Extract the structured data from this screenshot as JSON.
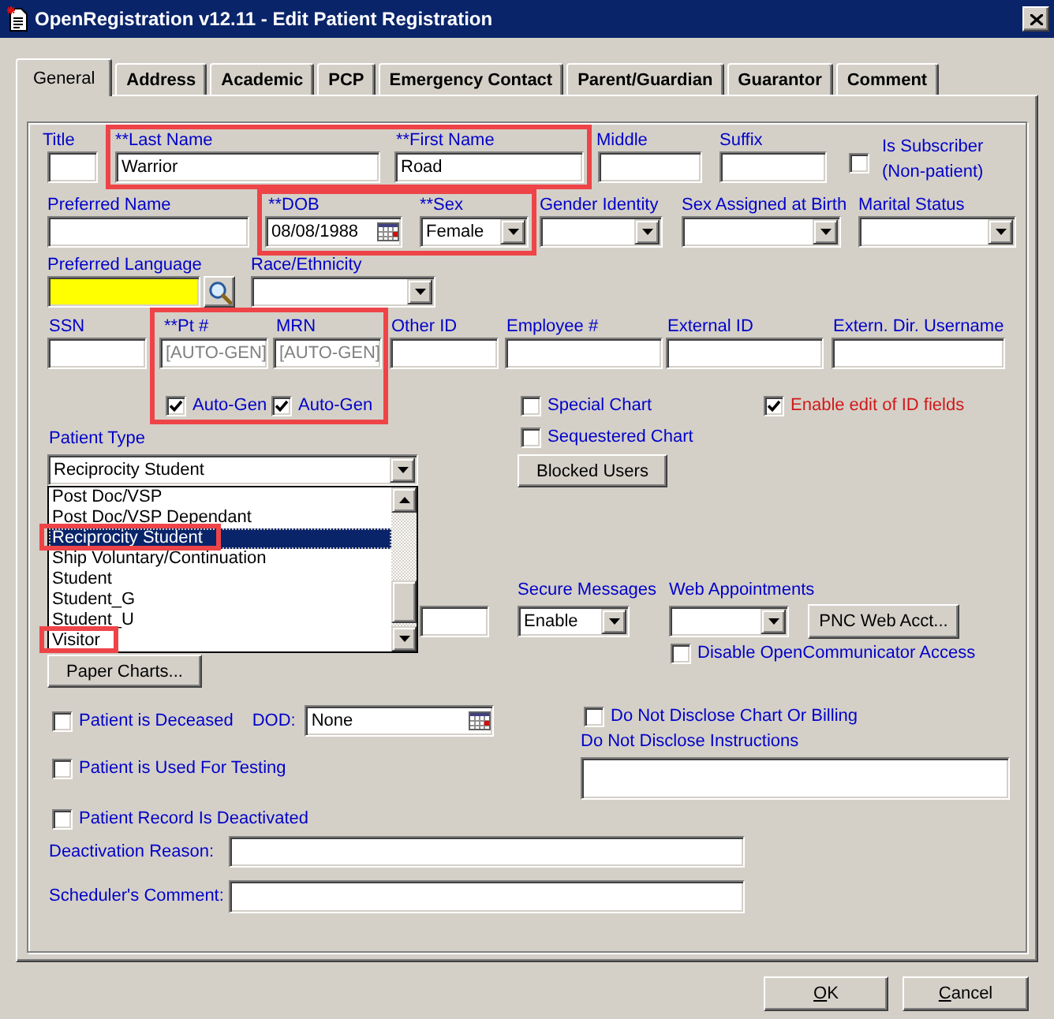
{
  "window": {
    "title": "OpenRegistration v12.11 - Edit Patient Registration"
  },
  "tabs": [
    {
      "label": "General",
      "selected": true
    },
    {
      "label": "Address",
      "selected": false
    },
    {
      "label": "Academic",
      "selected": false
    },
    {
      "label": "PCP",
      "selected": false
    },
    {
      "label": "Emergency Contact",
      "selected": false
    },
    {
      "label": "Parent/Guardian",
      "selected": false
    },
    {
      "label": "Guarantor",
      "selected": false
    },
    {
      "label": "Comment",
      "selected": false
    }
  ],
  "title_field": {
    "label": "Title"
  },
  "name_group": {
    "annotated": true,
    "last_name": {
      "label": "**Last Name",
      "value": "Warrior"
    },
    "first_name": {
      "label": "**First Name",
      "value": "Road"
    }
  },
  "middle": {
    "label": "Middle"
  },
  "suffix": {
    "label": "Suffix"
  },
  "is_subscriber": {
    "label": "Is Subscriber (Non-patient)",
    "checked": false
  },
  "preferred_name": {
    "label": "Preferred Name"
  },
  "dob_sex_group": {
    "annotated": true,
    "dob": {
      "label": "**DOB",
      "value": "08/08/1988"
    },
    "sex": {
      "label": "**Sex",
      "value": "Female"
    }
  },
  "gender_identity": {
    "label": "Gender Identity"
  },
  "sex_assigned_at_birth": {
    "label": "Sex Assigned at Birth"
  },
  "marital_status": {
    "label": "Marital Status"
  },
  "preferred_language": {
    "label": "Preferred Language",
    "required": true
  },
  "race_ethnicity": {
    "label": "Race/Ethnicity"
  },
  "ssn": {
    "label": "SSN"
  },
  "id_group": {
    "annotated": true,
    "fields": [
      {
        "label": "**Pt #",
        "placeholder": "[AUTO-GEN]",
        "auto_gen": {
          "label": "Auto-Gen",
          "checked": true
        }
      },
      {
        "label": "MRN",
        "placeholder": "[AUTO-GEN]",
        "auto_gen": {
          "label": "Auto-Gen",
          "checked": true
        }
      }
    ]
  },
  "other_ids": [
    {
      "label": "Other ID"
    },
    {
      "label": "Employee #"
    },
    {
      "label": "External ID"
    },
    {
      "label": "Extern. Dir. Username"
    }
  ],
  "special_chart": {
    "label": "Special Chart",
    "checked": false
  },
  "enable_edit_id_fields": {
    "label": "Enable edit of ID fields",
    "checked": true
  },
  "patient_type": {
    "label": "Patient Type",
    "value": "Reciprocity Student",
    "expanded": true,
    "options": [
      {
        "label": "Post Doc/VSP",
        "selected": false,
        "annotated": false
      },
      {
        "label": "Post Doc/VSP Dependant",
        "selected": false,
        "annotated": false
      },
      {
        "label": "Reciprocity Student",
        "selected": true,
        "annotated": true
      },
      {
        "label": "Ship Voluntary/Continuation",
        "selected": false,
        "annotated": false
      },
      {
        "label": "Student",
        "selected": false,
        "annotated": false
      },
      {
        "label": "Student_G",
        "selected": false,
        "annotated": false
      },
      {
        "label": "Student_U",
        "selected": false,
        "annotated": false
      },
      {
        "label": "Visitor",
        "selected": false,
        "annotated": true
      }
    ]
  },
  "sequestered_chart": {
    "label": "Sequestered Chart",
    "checked": false
  },
  "blocked_users_button": {
    "label": "Blocked Users"
  },
  "secure_messages": {
    "label": "Secure Messages",
    "value": "Enable"
  },
  "web_appointments": {
    "label": "Web Appointments"
  },
  "pnc_web_acct_button": {
    "label": "PNC Web Acct..."
  },
  "disable_opencommunicator": {
    "label": "Disable OpenCommunicator Access",
    "checked": false
  },
  "paper_charts_button": {
    "label": "Paper Charts..."
  },
  "patient_deceased": {
    "label": "Patient is Deceased",
    "checked": false
  },
  "dod": {
    "label": "DOD:",
    "value": "None"
  },
  "do_not_disclose": {
    "label": "Do Not Disclose Chart Or Billing",
    "checked": false
  },
  "do_not_disclose_instructions": {
    "label": "Do Not Disclose Instructions"
  },
  "used_for_testing": {
    "label": "Patient is Used For Testing",
    "checked": false
  },
  "record_deactivated": {
    "label": "Patient Record Is Deactivated",
    "checked": false
  },
  "deactivation_reason": {
    "label": "Deactivation Reason:"
  },
  "schedulers_comment": {
    "label": "Scheduler's Comment:"
  },
  "buttons": [
    {
      "label": "OK",
      "underline_first": true
    },
    {
      "label": "Cancel",
      "underline_first": true
    }
  ]
}
